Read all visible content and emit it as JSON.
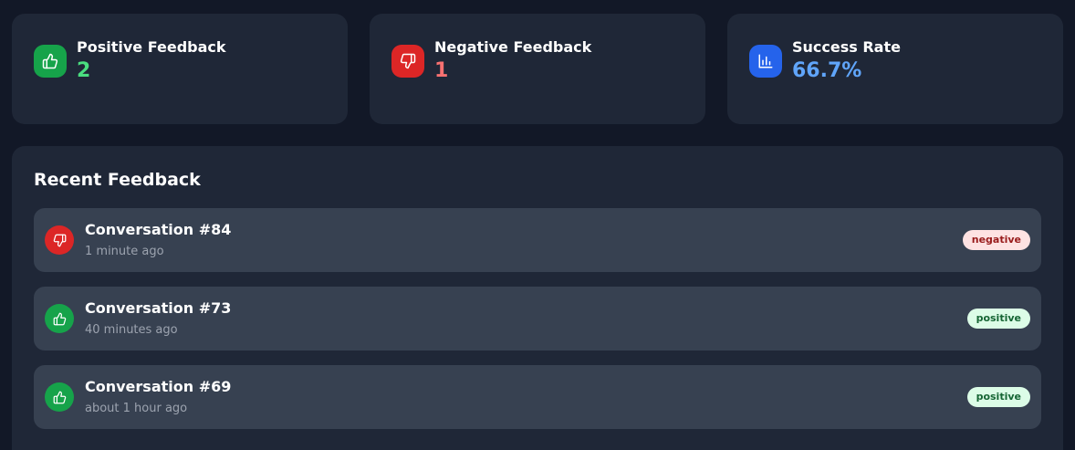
{
  "stats": [
    {
      "label": "Positive Feedback",
      "value": "2",
      "color": "#4ade80",
      "icon": "thumbs-up-icon"
    },
    {
      "label": "Negative Feedback",
      "value": "1",
      "color": "#f87171",
      "icon": "thumbs-down-icon"
    },
    {
      "label": "Success Rate",
      "value": "66.7%",
      "color": "#60a5fa",
      "icon": "bar-chart-icon"
    }
  ],
  "recent": {
    "title": "Recent Feedback",
    "items": [
      {
        "title": "Conversation #84",
        "time": "1 minute ago",
        "badge": "negative",
        "icon": "thumbs-down-icon"
      },
      {
        "title": "Conversation #73",
        "time": "40 minutes ago",
        "badge": "positive",
        "icon": "thumbs-up-icon"
      },
      {
        "title": "Conversation #69",
        "time": "about 1 hour ago",
        "badge": "positive",
        "icon": "thumbs-up-icon"
      }
    ]
  }
}
